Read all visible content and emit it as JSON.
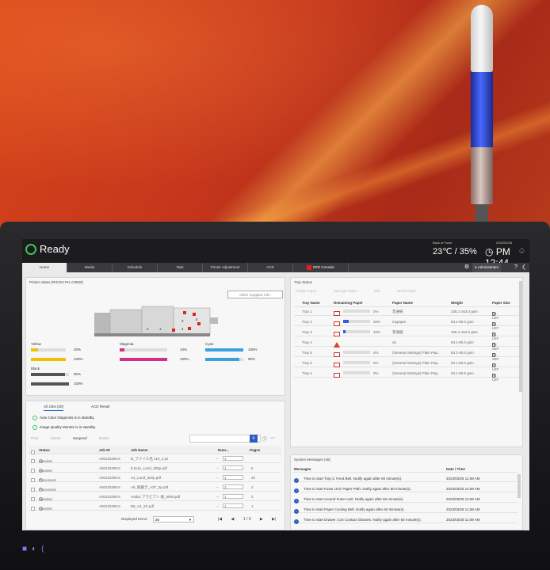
{
  "header": {
    "status": "Ready",
    "fuser_label": "Back of Fuser",
    "fuser_value": "23℃ / 35%",
    "date": "2023/03/28",
    "time": "PM 12:44"
  },
  "tabs": [
    "Home",
    "Media",
    "Schedule",
    "Task",
    "Printer Adjustment",
    "ACD",
    "DFE Console"
  ],
  "user": "Administrator",
  "printer": {
    "title": "Printer status (RICOH Pro C9500)",
    "other_supplies": "Other Supplies Info.",
    "toners": [
      {
        "name": "Yellow",
        "pct": "20%",
        "level": 0.2,
        "color": "#f0c000"
      },
      {
        "name": "Magenta",
        "pct": "10%",
        "level": 0.1,
        "color": "#d0308a"
      },
      {
        "name": "Cyan",
        "pct": "100%",
        "level": 1.0,
        "color": "#3aa0e0"
      },
      {
        "name": "Black",
        "pct": "90%",
        "level": 0.9,
        "color": "#555555"
      }
    ],
    "sub_pcts": [
      "100%",
      "100%",
      "90%",
      "100%"
    ],
    "sub_levels": [
      1.0,
      1.0,
      0.9,
      1.0
    ],
    "tray_labels": [
      "2",
      "1",
      "3",
      "4",
      "5"
    ]
  },
  "jobs": {
    "tab_all": "All Jobs (20)",
    "tab_acd": "ACD Result",
    "status1": "Auto Color Diagnosis is in standby.",
    "status2": "Image Quality Monitor is in standby.",
    "toolbar": [
      "Print",
      "Delete",
      "Suspend",
      "Delete"
    ],
    "columns": [
      "Status",
      "Job ID",
      "Job Name",
      "Num...",
      "Pages"
    ],
    "rows": [
      {
        "status": "Spooled",
        "id": "A00120290.6",
        "name": "B_ファイル名 110_4.ps",
        "num": "1",
        "pages": ""
      },
      {
        "status": "Spooled",
        "id": "A00120290.6",
        "name": "8.5x11_Land_305p.pdf",
        "num": "1",
        "pages": "5"
      },
      {
        "status": "Processed",
        "id": "A00120290.6",
        "name": "A4_Land_320p.pdf",
        "num": "1",
        "pages": "20"
      },
      {
        "status": "Processed",
        "id": "A00120290.6",
        "name": "A5_縦書き_A3T_2p.pdf",
        "num": "2",
        "pages": "2"
      },
      {
        "status": "Spooled",
        "id": "A00120290.6",
        "name": "Arabic アラビアン 縦_5809.pdf",
        "num": "1",
        "pages": "2"
      },
      {
        "status": "Spooled",
        "id": "A00120290.6",
        "name": "B5_A4_2S.pdf",
        "num": "1",
        "pages": "1"
      }
    ],
    "displayed_label": "Displayed Items:",
    "displayed_value": "20",
    "page": "1 / 3"
  },
  "trays": {
    "title": "Tray Status",
    "toolbar": [
      "Assign Paper",
      "Manage Paper",
      "Edit",
      "Stock Paper"
    ],
    "columns": [
      "Tray Name",
      "Remaining Paper",
      "Paper Name",
      "Weight",
      "Paper Size"
    ],
    "rows": [
      {
        "name": "Tray 1",
        "pct": "0%",
        "level": 0.0,
        "icon": "tray",
        "paper": "普通紙",
        "weight": "105.1-163.0 gsm",
        "size": "A4 LEF"
      },
      {
        "name": "Tray 2",
        "pct": "20%",
        "level": 0.2,
        "icon": "tray",
        "paper": "mypaper",
        "weight": "63.1-80.0 gsm",
        "size": "A4 LEF"
      },
      {
        "name": "Tray 3",
        "pct": "10%",
        "level": 0.1,
        "icon": "tray",
        "paper": "普通紙",
        "weight": "105.1-163.0 gsm",
        "size": "A4 LEF"
      },
      {
        "name": "Tray 4",
        "pct": "",
        "level": 0.0,
        "icon": "warn",
        "paper": "ok",
        "weight": "63.1-80.0 gsm",
        "size": "A3 SEF"
      },
      {
        "name": "Tray 5",
        "pct": "0%",
        "level": 0.0,
        "icon": "tray",
        "paper": "(General Settings) Plain Pap...",
        "weight": "63.1-80.0 gsm",
        "size": "A3 SEF"
      },
      {
        "name": "Tray 6",
        "pct": "0%",
        "level": 0.0,
        "icon": "tray",
        "paper": "(General Settings) Plain Pap...",
        "weight": "63.1-80.0 gsm",
        "size": "A4 LEF"
      },
      {
        "name": "Tray A",
        "pct": "0%",
        "level": 0.0,
        "icon": "tray",
        "paper": "(General Settings) Plain Pap...",
        "weight": "63.1-80.0 gsm",
        "size": "A4 LEF"
      }
    ]
  },
  "messages": {
    "title": "System Messages (45)",
    "col_msg": "Messages",
    "col_date": "Date / Time",
    "rows": [
      {
        "text": "Time to start Tray 2: Feed Belt. Notify again after 60 minute(s).",
        "date": "2023/03/28 11:59 AM"
      },
      {
        "text": "Time to start Fuser Unit: Paper Path. Notify again after 60 minute(s).",
        "date": "2023/03/28 11:59 AM"
      },
      {
        "text": "Time to start Around Fuser Unit. Notify again after 60 minute(s).",
        "date": "2023/03/28 11:59 AM"
      },
      {
        "text": "Time to start Paper Cooling Belt. Notify again after 60 minute(s).",
        "date": "2023/03/28 11:59 AM"
      },
      {
        "text": "Time to start Drawer: CIS Contact Glasses. Notify again after 60 minute(s).",
        "date": "2023/03/28 11:59 AM"
      }
    ]
  }
}
